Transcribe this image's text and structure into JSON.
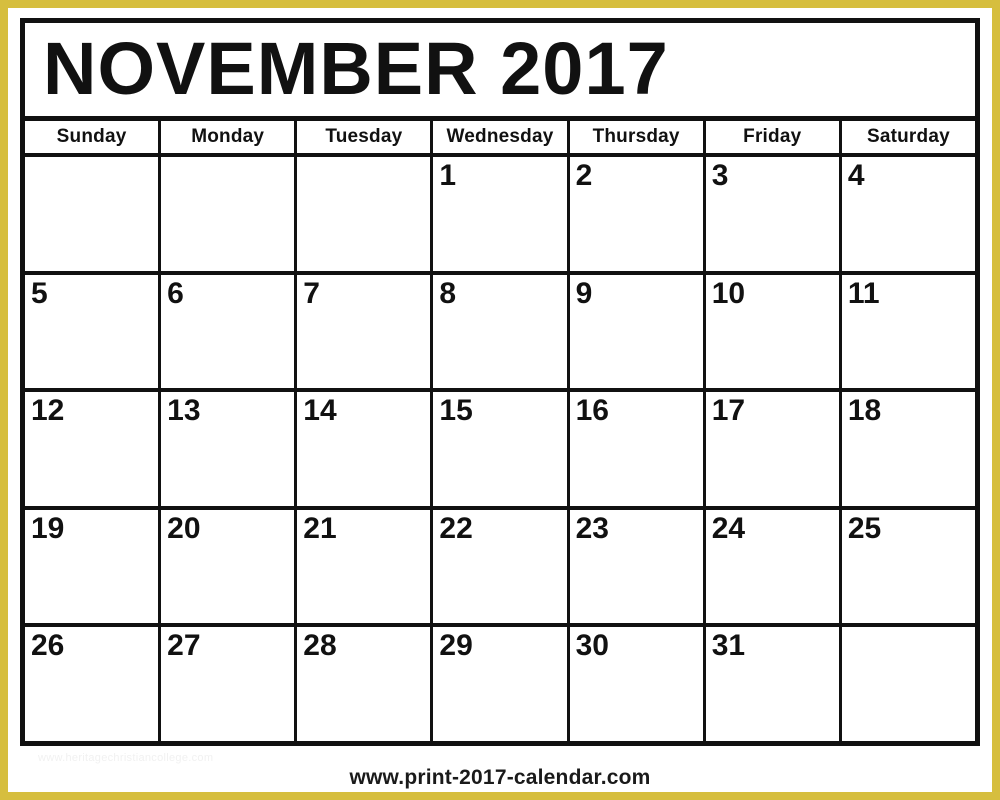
{
  "document": {
    "type": "printable-monthly-calendar",
    "month": "NOVEMBER",
    "year": "2017",
    "title": "NOVEMBER 2017"
  },
  "theme": {
    "border_color": "#d6be3e",
    "grid_color": "#111111",
    "page_background": "#ffffff",
    "text_color": "#111111",
    "watermark_color": "#f1f1f1"
  },
  "weekdays": [
    {
      "label": "Sunday"
    },
    {
      "label": "Monday"
    },
    {
      "label": "Tuesday"
    },
    {
      "label": "Wednesday"
    },
    {
      "label": "Thursday"
    },
    {
      "label": "Friday"
    },
    {
      "label": "Saturday"
    }
  ],
  "weeks": [
    {
      "days": [
        {
          "date": ""
        },
        {
          "date": ""
        },
        {
          "date": ""
        },
        {
          "date": "1"
        },
        {
          "date": "2"
        },
        {
          "date": "3"
        },
        {
          "date": "4"
        }
      ]
    },
    {
      "days": [
        {
          "date": "5"
        },
        {
          "date": "6"
        },
        {
          "date": "7"
        },
        {
          "date": "8"
        },
        {
          "date": "9"
        },
        {
          "date": "10"
        },
        {
          "date": "11"
        }
      ]
    },
    {
      "days": [
        {
          "date": "12"
        },
        {
          "date": "13"
        },
        {
          "date": "14"
        },
        {
          "date": "15"
        },
        {
          "date": "16"
        },
        {
          "date": "17"
        },
        {
          "date": "18"
        }
      ]
    },
    {
      "days": [
        {
          "date": "19"
        },
        {
          "date": "20"
        },
        {
          "date": "21"
        },
        {
          "date": "22"
        },
        {
          "date": "23"
        },
        {
          "date": "24"
        },
        {
          "date": "25"
        }
      ]
    },
    {
      "days": [
        {
          "date": "26"
        },
        {
          "date": "27"
        },
        {
          "date": "28"
        },
        {
          "date": "29"
        },
        {
          "date": "30"
        },
        {
          "date": "31"
        },
        {
          "date": ""
        }
      ]
    }
  ],
  "footer": {
    "url": "www.print-2017-calendar.com",
    "watermark": "www.heritagechristiancollege.com"
  }
}
